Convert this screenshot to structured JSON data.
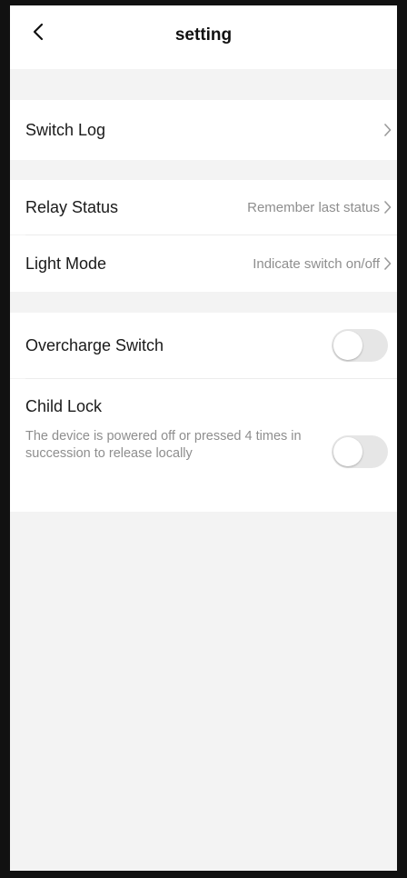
{
  "header": {
    "title": "setting"
  },
  "icons": {
    "back": "chevron-left-icon",
    "arrow": "chevron-right-icon"
  },
  "switch_log": {
    "label": "Switch Log"
  },
  "relay_status": {
    "label": "Relay Status",
    "value": "Remember last status"
  },
  "light_mode": {
    "label": "Light Mode",
    "value": "Indicate switch on/off"
  },
  "overcharge_switch": {
    "label": "Overcharge Switch",
    "enabled": false
  },
  "child_lock": {
    "label": "Child Lock",
    "description": "The device is powered off or pressed 4 times in succession to release locally",
    "enabled": false
  },
  "colors": {
    "background": "#f3f3f3",
    "card": "#ffffff",
    "text": "#1a1a1a",
    "secondary_text": "#8e8e8e",
    "toggle_off": "#e6e6e6",
    "frame": "#111111"
  }
}
